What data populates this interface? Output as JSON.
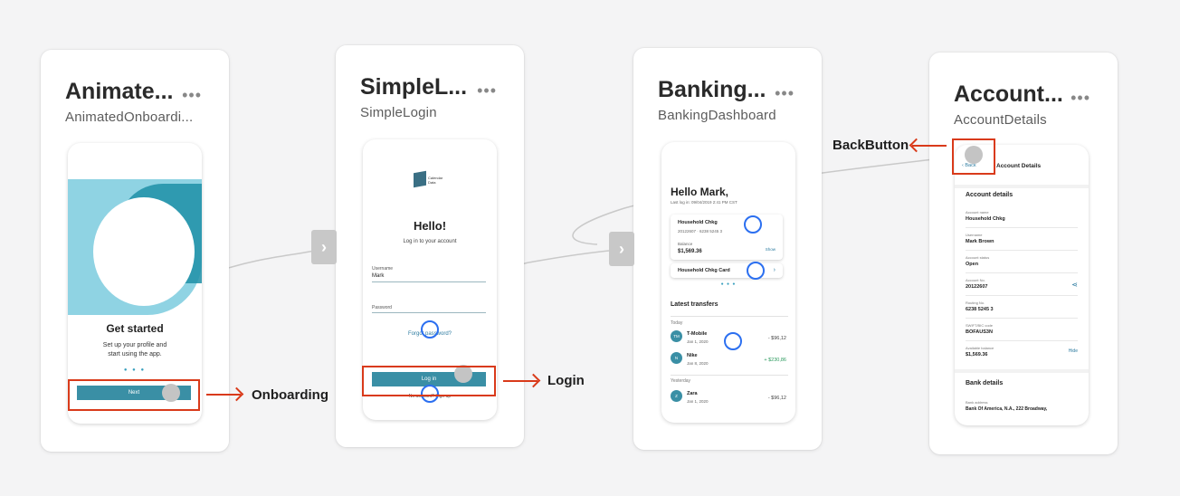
{
  "screens": [
    {
      "title": "Animate...",
      "subtitle": "AnimatedOnboardi...",
      "more": "•••",
      "phone": {
        "heading": "Get started",
        "text": "Set up your profile and start using the app.",
        "dots": "● ● ●",
        "button": "Next"
      }
    },
    {
      "title": "SimpleL...",
      "subtitle": "SimpleLogin",
      "more": "•••",
      "phone": {
        "logo_text": "Calendar Data",
        "heading": "Hello!",
        "sub": "Log in to your account",
        "username_label": "Username",
        "username_value": "Mark",
        "password_label": "Password",
        "forgot": "Forgot password?",
        "button": "Log in",
        "signup": "No account? Sign up"
      }
    },
    {
      "title": "Banking...",
      "subtitle": "BankingDashboard",
      "more": "•••",
      "phone": {
        "greeting": "Hello Mark,",
        "last_login": "Last log in: 09/04/2019 2:41 PM CST",
        "account_name": "Household Chkg",
        "account_number": "20122607 · 6238 5245 3",
        "balance_label": "Balance",
        "balance": "$1,569.36",
        "show": "Show",
        "card_name": "Household Chkg Card",
        "pager": "● ● ●",
        "transfers_title": "Latest transfers",
        "today": "Today",
        "yesterday": "Yesterday",
        "transfers": [
          {
            "initials": "TM",
            "name": "T-Mobile",
            "date": "Jan 1, 2020",
            "amount": "- $96,12"
          },
          {
            "initials": "N",
            "name": "Nike",
            "date": "Jan 8, 2020",
            "amount": "+ $230,86"
          },
          {
            "initials": "Z",
            "name": "Zara",
            "date": "Jan 1, 2020",
            "amount": "- $96,12"
          }
        ]
      }
    },
    {
      "title": "Account...",
      "subtitle": "AccountDetails",
      "more": "•••",
      "phone": {
        "back": "Back",
        "title": "Account Details",
        "section1": "Account details",
        "fields": [
          {
            "key": "Account name",
            "value": "Household Chkg"
          },
          {
            "key": "Username",
            "value": "Mark Brown"
          },
          {
            "key": "Account status",
            "value": "Open"
          },
          {
            "key": "Account No.",
            "value": "20122607"
          },
          {
            "key": "Routing No.",
            "value": "6238 5245 3"
          },
          {
            "key": "SWIFT/BIC code",
            "value": "BOFAUS3N"
          },
          {
            "key": "Available balance",
            "value": "$1,569.36"
          }
        ],
        "hide": "Hide",
        "section2": "Bank details",
        "bank_address_label": "Bank address",
        "bank_address": "Bank Of America, N.A., 222 Broadway,"
      }
    }
  ],
  "annotations": {
    "onboarding": "Onboarding",
    "login": "Login",
    "back_button": "BackButton"
  },
  "nav_arrow": "›",
  "colors": {
    "accent": "#3a8fa5",
    "hotspot": "#2b6ff0",
    "annotation": "#d93a1a"
  }
}
